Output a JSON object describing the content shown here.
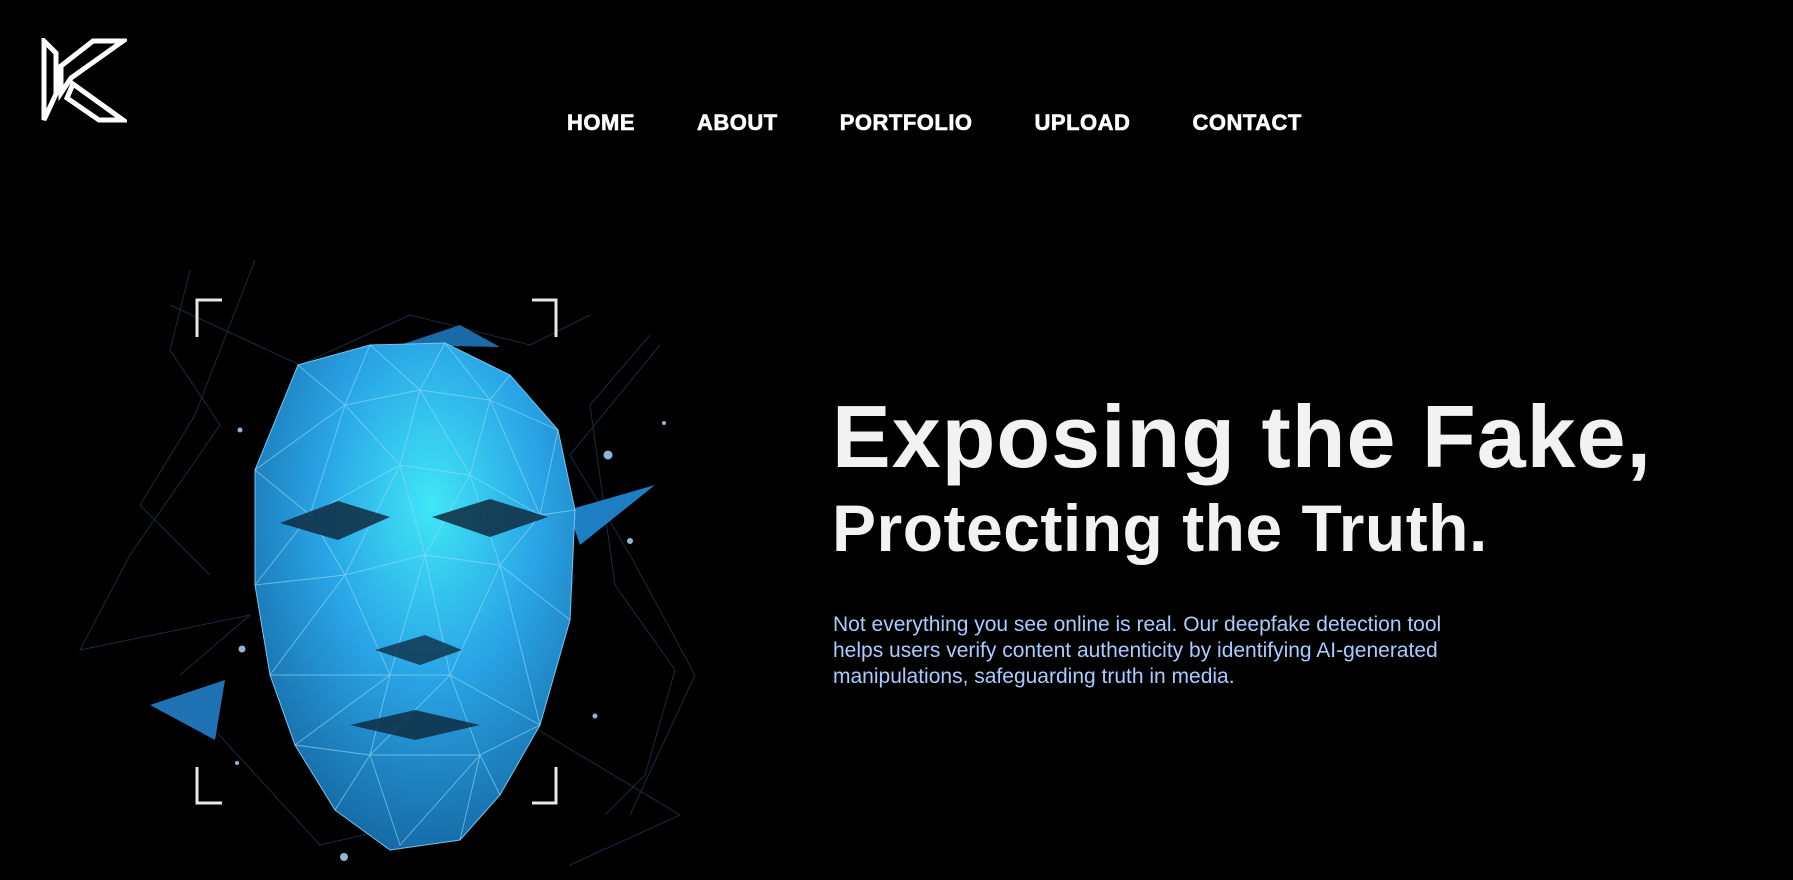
{
  "logo": {
    "icon": "k-monogram-logo"
  },
  "nav": {
    "items": [
      {
        "label": "HOME"
      },
      {
        "label": "ABOUT"
      },
      {
        "label": "PORTFOLIO"
      },
      {
        "label": "UPLOAD"
      },
      {
        "label": "CONTACT"
      }
    ]
  },
  "hero": {
    "headline_line1": "Exposing the Fake,",
    "headline_line2": "Protecting the Truth.",
    "description": "Not everything you see online is real. Our deepfake detection tool helps users verify content authenticity by identifying AI-generated manipulations, safeguarding truth in media.",
    "image": "low-poly-face-scan-illustration"
  },
  "colors": {
    "background": "#000000",
    "text": "#ffffff",
    "description": "#a9ccff",
    "face_primary": "#2fa7e6",
    "face_highlight": "#3fe3f5"
  }
}
